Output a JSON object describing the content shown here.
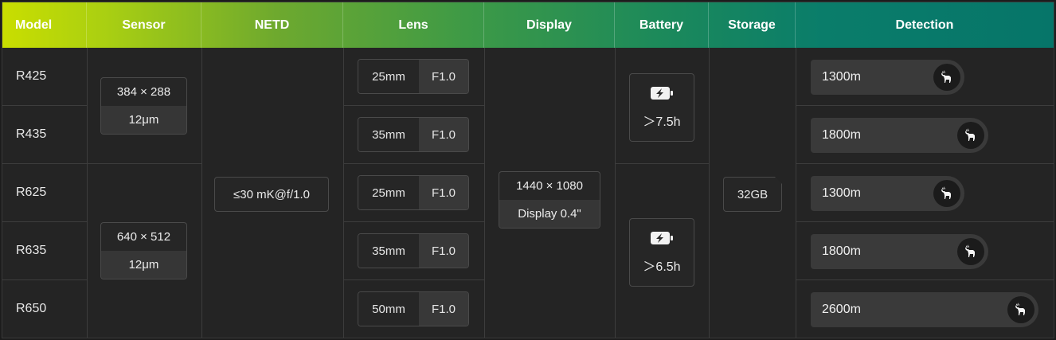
{
  "headers": [
    "Model",
    "Sensor",
    "NETD",
    "Lens",
    "Display",
    "Battery",
    "Storage",
    "Detection"
  ],
  "models": [
    "R425",
    "R435",
    "R625",
    "R635",
    "R650"
  ],
  "sensors": [
    {
      "resolution": "384 × 288",
      "pitch": "12μm"
    },
    {
      "resolution": "640 × 512",
      "pitch": "12μm"
    }
  ],
  "netd": "≤30 mK@f/1.0",
  "lenses": [
    {
      "focal": "25mm",
      "aperture": "F1.0"
    },
    {
      "focal": "35mm",
      "aperture": "F1.0"
    },
    {
      "focal": "25mm",
      "aperture": "F1.0"
    },
    {
      "focal": "35mm",
      "aperture": "F1.0"
    },
    {
      "focal": "50mm",
      "aperture": "F1.0"
    }
  ],
  "display": {
    "resolution": "1440 × 1080",
    "size": "Display 0.4\""
  },
  "batteries": [
    {
      "label": "＞7.5h",
      "icon": "battery-charging-icon"
    },
    {
      "label": "＞6.5h",
      "icon": "battery-charging-icon"
    }
  ],
  "storage": "32GB",
  "detection": [
    {
      "range": "1300m",
      "icon": "deer-icon"
    },
    {
      "range": "1800m",
      "icon": "deer-icon"
    },
    {
      "range": "1300m",
      "icon": "deer-icon"
    },
    {
      "range": "1800m",
      "icon": "deer-icon"
    },
    {
      "range": "2600m",
      "icon": "deer-icon"
    }
  ],
  "colors": {
    "header_start": "#c9de00",
    "header_end": "#067569",
    "cell_bg": "#242424",
    "pill_bg": "#3a3a3a"
  }
}
